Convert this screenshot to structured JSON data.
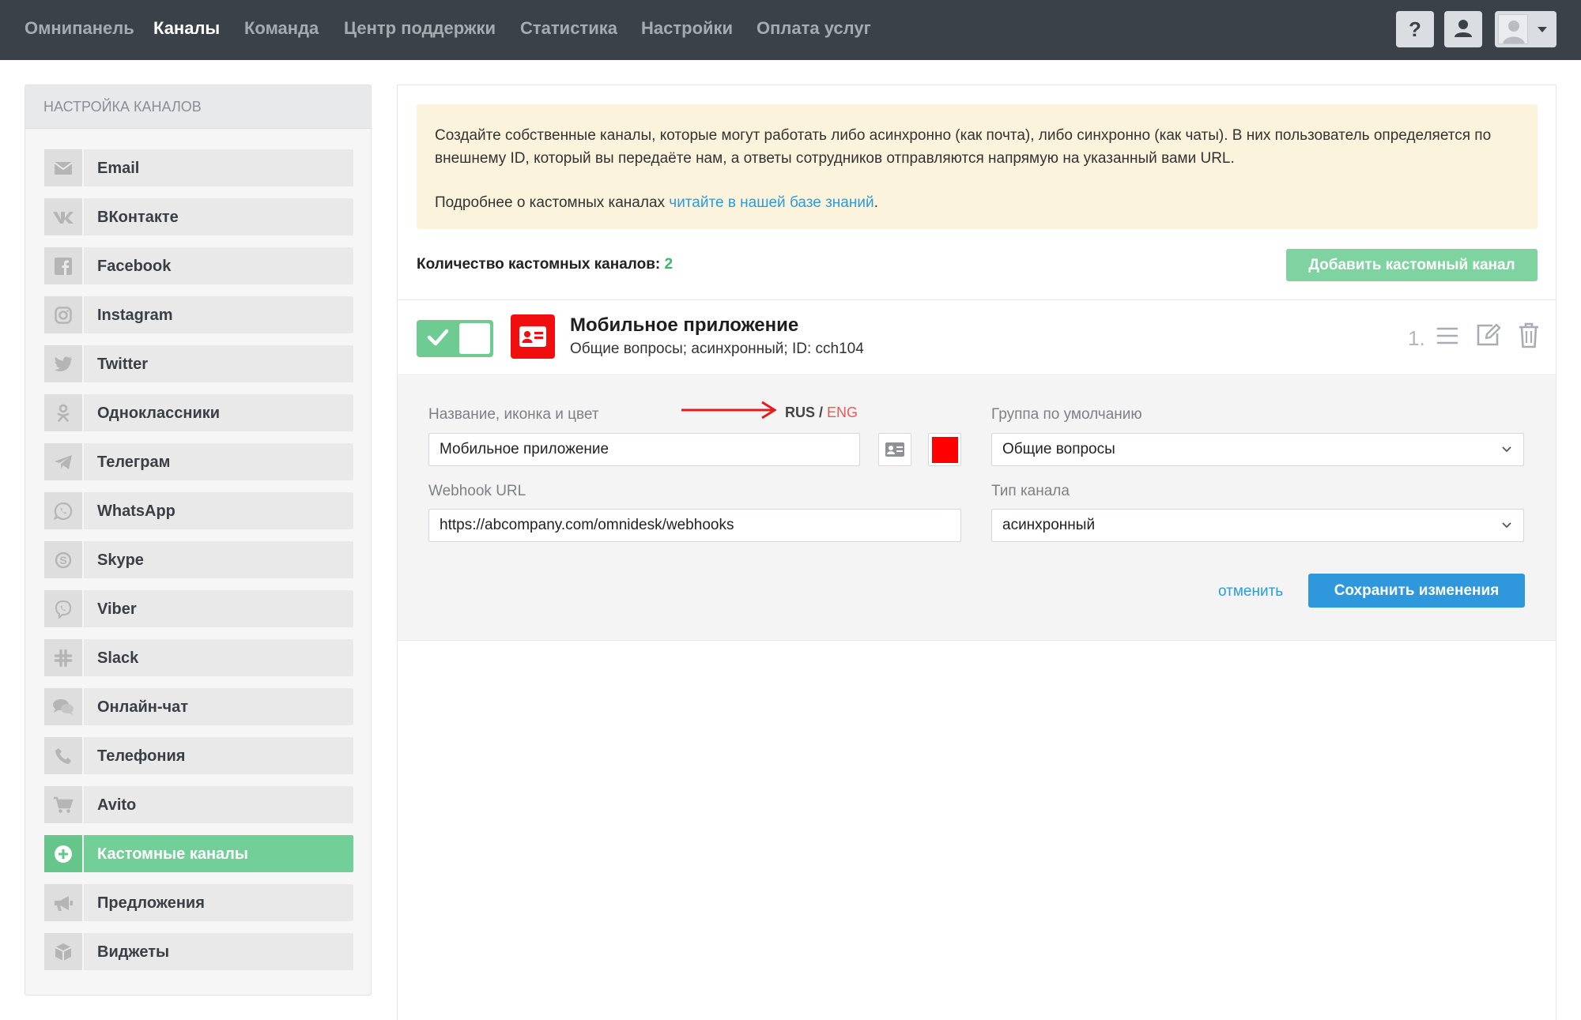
{
  "topnav": {
    "items": [
      "Омнипанель",
      "Каналы",
      "Команда",
      "Центр поддержки",
      "Статистика",
      "Настройки",
      "Оплата услуг"
    ],
    "active": "Каналы",
    "help_label": "?"
  },
  "sidebar": {
    "title": "НАСТРОЙКА КАНАЛОВ",
    "items": [
      {
        "label": "Email",
        "icon": "envelope-icon"
      },
      {
        "label": "ВКонтакте",
        "icon": "vk-icon"
      },
      {
        "label": "Facebook",
        "icon": "facebook-icon"
      },
      {
        "label": "Instagram",
        "icon": "instagram-icon"
      },
      {
        "label": "Twitter",
        "icon": "twitter-icon"
      },
      {
        "label": "Одноклассники",
        "icon": "odnoklassniki-icon"
      },
      {
        "label": "Телеграм",
        "icon": "telegram-icon"
      },
      {
        "label": "WhatsApp",
        "icon": "whatsapp-icon"
      },
      {
        "label": "Skype",
        "icon": "skype-icon"
      },
      {
        "label": "Viber",
        "icon": "viber-icon"
      },
      {
        "label": "Slack",
        "icon": "slack-icon"
      },
      {
        "label": "Онлайн-чат",
        "icon": "chat-bubbles-icon"
      },
      {
        "label": "Телефония",
        "icon": "phone-icon"
      },
      {
        "label": "Avito",
        "icon": "cart-icon"
      },
      {
        "label": "Кастомные каналы",
        "icon": "plus-circle-icon"
      },
      {
        "label": "Предложения",
        "icon": "megaphone-icon"
      },
      {
        "label": "Виджеты",
        "icon": "cube-icon"
      }
    ],
    "active_index": 14
  },
  "info": {
    "text": "Создайте собственные каналы, которые могут работать либо асинхронно (как почта), либо синхронно (как чаты). В них пользователь определяется по внешнему ID, который вы передаёте нам, а ответы сотрудников отправляются напрямую на указанный вами URL.",
    "more_prefix": "Подробнее о кастомных каналах ",
    "more_link": "читайте в нашей базе знаний",
    "more_suffix": "."
  },
  "channels": {
    "count_label": "Количество кастомных каналов:",
    "count": "2",
    "add_button": "Добавить кастомный канал"
  },
  "channel": {
    "title": "Мобильное приложение",
    "subtitle": "Общие вопросы; асинхронный; ID: cch104",
    "index": "1.",
    "enabled": true,
    "color": "#ff0000"
  },
  "form": {
    "name_label": "Название, иконка и цвет",
    "lang_rus": "RUS",
    "lang_sep": " / ",
    "lang_eng": "ENG",
    "name_value": "Мобильное приложение",
    "group_label": "Группа по умолчанию",
    "group_value": "Общие вопросы",
    "webhook_label": "Webhook URL",
    "webhook_value": "https://abcompany.com/omnidesk/webhooks",
    "type_label": "Тип канала",
    "type_value": "асинхронный",
    "cancel": "отменить",
    "save": "Сохранить изменения"
  },
  "colors": {
    "accent_green": "#72cf97",
    "accent_blue": "#2f98dc",
    "channel_red": "#f00e0e",
    "topbar": "#3b4149"
  }
}
